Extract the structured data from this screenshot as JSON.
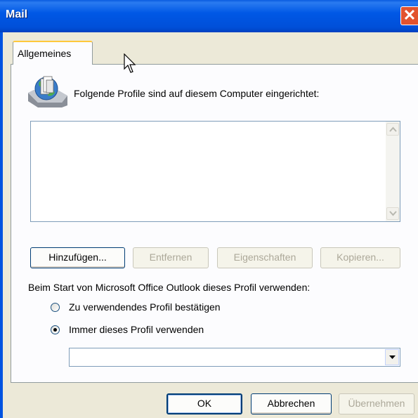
{
  "window": {
    "title": "Mail",
    "close_glyph": "✕"
  },
  "tabs": [
    {
      "label": "Allgemeines",
      "active": true
    }
  ],
  "general": {
    "icon": "mail-profiles-icon",
    "caption": "Folgende Profile sind auf diesem Computer eingerichtet:",
    "profiles": [],
    "buttons": {
      "add": "Hinzufügen...",
      "remove": "Entfernen",
      "properties": "Eigenschaften",
      "copy": "Kopieren..."
    },
    "startup_caption": "Beim Start von Microsoft Office Outlook dieses Profil verwenden:",
    "radios": [
      {
        "label": "Zu verwendendes Profil bestätigen",
        "checked": false
      },
      {
        "label": "Immer dieses Profil verwenden",
        "checked": true
      }
    ],
    "profile_select": {
      "value": ""
    }
  },
  "footer": {
    "ok": "OK",
    "cancel": "Abbrechen",
    "apply": "Übernehmen"
  }
}
